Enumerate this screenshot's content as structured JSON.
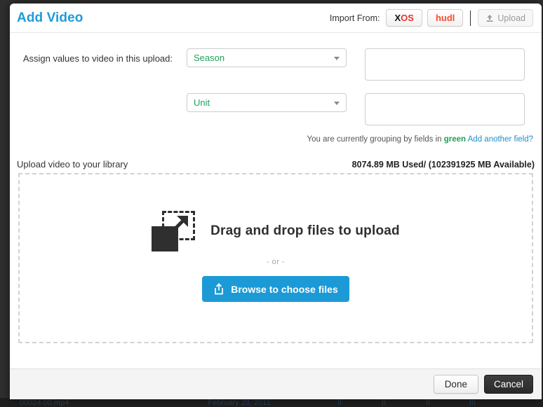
{
  "modal": {
    "title": "Add Video",
    "header": {
      "import_label": "Import From:",
      "sources": [
        {
          "id": "xos",
          "label": "XOS",
          "label_part1": "X",
          "label_part2": "OS",
          "color_primary": "#111111",
          "color_accent": "#e8342a"
        },
        {
          "id": "hudl",
          "label": "hudl",
          "color": "#fa4b2a"
        }
      ],
      "upload_button": {
        "label": "Upload",
        "icon": "upload-icon",
        "disabled": true
      }
    },
    "assign": {
      "label": "Assign values to video in this upload:",
      "rows": [
        {
          "select_value": "Season",
          "input_value": "",
          "input_placeholder": ""
        },
        {
          "select_value": "Unit",
          "input_value": "",
          "input_placeholder": ""
        }
      ],
      "grouping_note": {
        "prefix": "You are currently grouping by fields in",
        "highlight": "green",
        "link": "Add another field?",
        "highlight_color": "#21a05b",
        "link_color": "#1e8fcb"
      }
    },
    "upload_section": {
      "heading": "Upload video to your library",
      "storage": "8074.89 MB Used/ (102391925 MB Available)",
      "storage_used": "8074.89 MB Used",
      "storage_available": "(102391925 MB Available)",
      "dropzone": {
        "icon": "drag-drop-icon",
        "text": "Drag and drop files to upload",
        "or": "- or -",
        "browse_button": {
          "label": "Browse to choose files",
          "icon": "share-upload-icon",
          "color": "#1c9ad6"
        }
      }
    },
    "footer": {
      "done_label": "Done",
      "cancel_label": "Cancel"
    }
  },
  "background": {
    "row": {
      "col1": "00024.00.mp4",
      "col2": "February 28, 2011",
      "col3": "II",
      "col4": "II",
      "col5": "II",
      "col6": "III"
    }
  },
  "theme": {
    "title_blue": "#1e9cd7",
    "accent_blue": "#1c9ad6",
    "green": "#21a05b",
    "red": "#e8342a",
    "orange": "#fa4b2a"
  }
}
